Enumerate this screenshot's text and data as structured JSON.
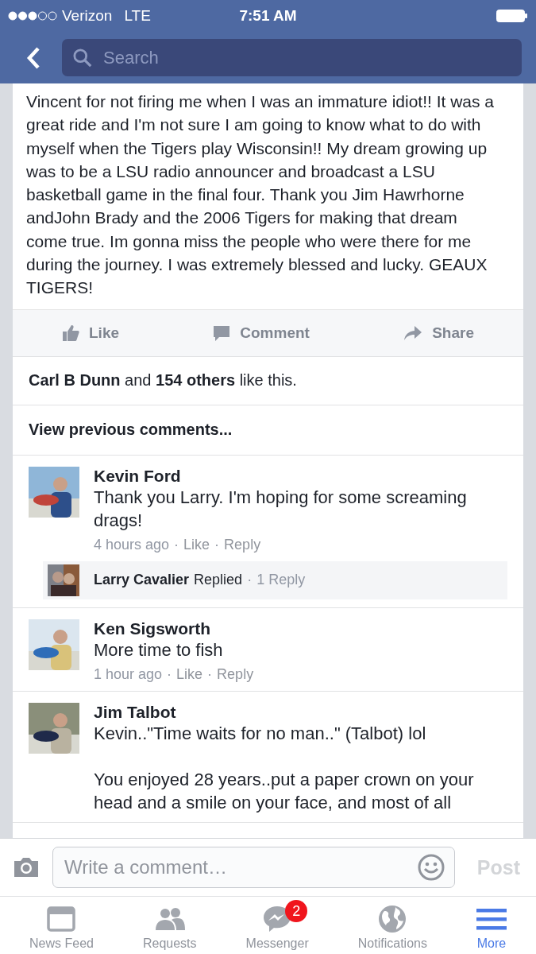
{
  "status_bar": {
    "carrier": "Verizon",
    "network": "LTE",
    "time": "7:51 AM"
  },
  "nav": {
    "search": {
      "placeholder": "Search"
    }
  },
  "post": {
    "text": "Vincent for not firing me when I was an immature idiot!! It was a great ride and I'm not sure I am going to know what to do with myself when the Tigers play Wisconsin!! My dream growing up was to be a LSU radio announcer and broadcast a LSU basketball game in the final four. Thank you Jim Hawrhorne andJohn Brady and the 2006 Tigers for making that dream come true. Im gonna miss the people who were there for me during the journey. I was extremely blessed and lucky. GEAUX TIGERS!",
    "actions": [
      {
        "kind": "like",
        "label": "Like"
      },
      {
        "kind": "comment",
        "label": "Comment"
      },
      {
        "kind": "share",
        "label": "Share"
      }
    ],
    "likes": "**Carl B Dunn** and **154 others** like this.",
    "view_previous": "View previous comments..."
  },
  "comments": [
    {
      "author": "Kevin Ford",
      "text": "Thank you Larry. I'm hoping for some screaming drags!",
      "time": "4 hours ago",
      "separator": "·",
      "actions": [
        "Like",
        "Reply"
      ],
      "reply_summary": {
        "author": "Larry Cavalier",
        "label": "Replied",
        "separator": "·",
        "count": "1 Reply"
      }
    },
    {
      "author": "Ken Sigsworth",
      "text": "More time to fish",
      "time": "1 hour ago",
      "separator": "·",
      "actions": [
        "Like",
        "Reply"
      ]
    },
    {
      "author": "Jim Talbot",
      "text": "Kevin..\"Time waits for no man..\" (Talbot) lol\n\nYou enjoyed 28 years..put a paper crown on your head and a smile on your face, and most of all"
    }
  ],
  "composer": {
    "placeholder": "Write a comment…",
    "post_button": {
      "label": "Post",
      "disabled": true
    }
  },
  "tabs": [
    {
      "kind": "feed",
      "label": "News Feed",
      "selected": false
    },
    {
      "kind": "requests",
      "label": "Requests",
      "selected": false
    },
    {
      "kind": "messenger",
      "label": "Messenger",
      "selected": false,
      "badge": "2"
    },
    {
      "kind": "globe",
      "label": "Notifications",
      "selected": false
    },
    {
      "kind": "menu",
      "label": "More",
      "selected": true
    }
  ]
}
